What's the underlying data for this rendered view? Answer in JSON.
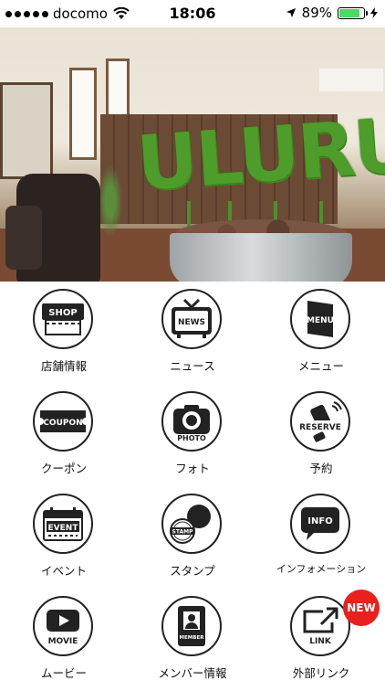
{
  "status_bar": {
    "carrier": "docomo",
    "time": "18:06",
    "battery_percent": "89%",
    "battery_level": 0.89,
    "signal_dots": 5
  },
  "hero": {
    "logo_text": "ULURU"
  },
  "menu": {
    "items": [
      {
        "label": "店舗情報",
        "icon_text": "SHOP",
        "icon": "shop-icon"
      },
      {
        "label": "ニュース",
        "icon_text": "NEWS",
        "icon": "news-tv-icon"
      },
      {
        "label": "メニュー",
        "icon_text": "MENU",
        "icon": "menu-book-icon"
      },
      {
        "label": "クーポン",
        "icon_text": "COUPON",
        "icon": "coupon-icon"
      },
      {
        "label": "フォト",
        "icon_text": "PHOTO",
        "icon": "camera-icon"
      },
      {
        "label": "予約",
        "icon_text": "RESERVE",
        "icon": "reserve-phone-icon"
      },
      {
        "label": "イベント",
        "icon_text": "EVENT",
        "icon": "calendar-icon"
      },
      {
        "label": "スタンプ",
        "icon_text": "STAMP",
        "icon": "stamp-icon"
      },
      {
        "label": "インフォメーション",
        "icon_text": "INFO",
        "icon": "info-bubble-icon"
      },
      {
        "label": "ムービー",
        "icon_text": "MOVIE",
        "icon": "movie-play-icon"
      },
      {
        "label": "メンバー情報",
        "icon_text": "MEMBER",
        "icon": "member-card-icon"
      },
      {
        "label": "外部リンク",
        "icon_text": "LINK",
        "icon": "external-link-icon"
      }
    ],
    "new_badge": "NEW"
  },
  "colors": {
    "accent_red": "#e8201e",
    "icon_dark": "#222222",
    "battery_green": "#4cd964"
  }
}
